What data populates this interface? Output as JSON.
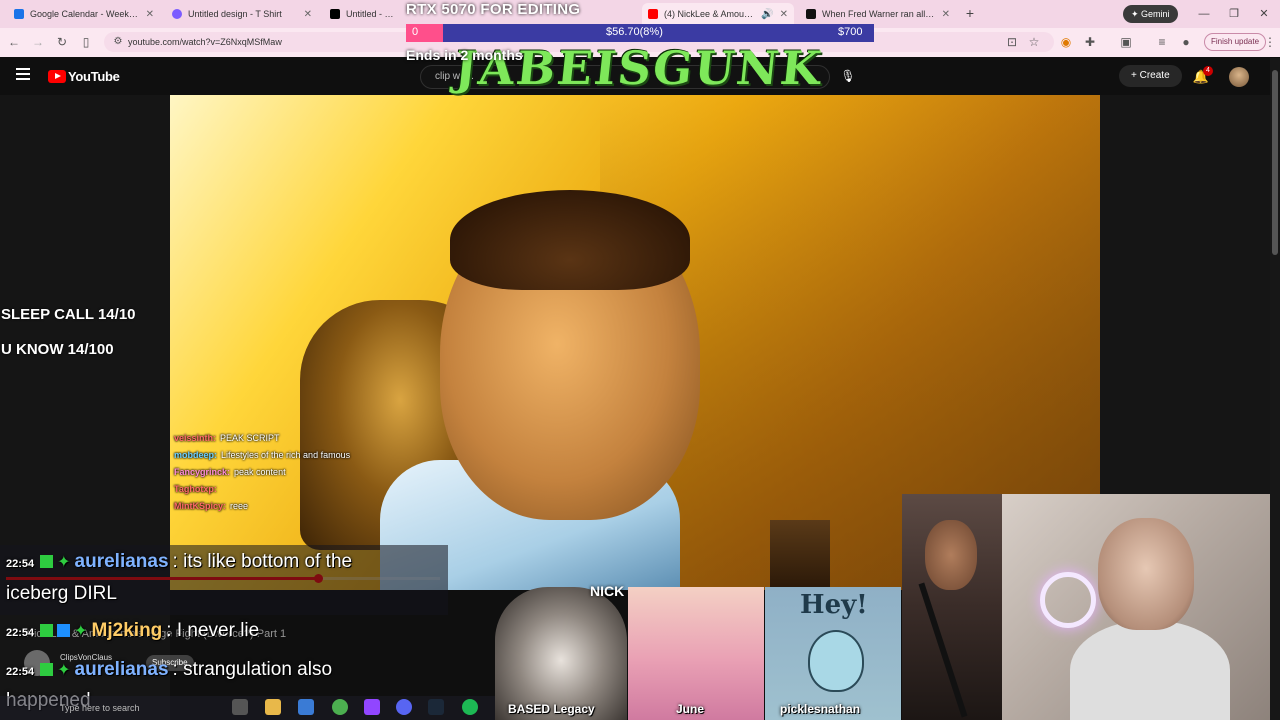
{
  "browser": {
    "tabs": [
      {
        "label": "Google Calendar - Week of Ma",
        "favicon_color": "#1a73e8",
        "active": false
      },
      {
        "label": "Untitled design - T Shirt",
        "favicon_color": "#7b5cff",
        "active": false
      },
      {
        "label": "Untitled - February 27, 2026",
        "favicon_color": "#000000",
        "active": false
      },
      {
        "label": "(4) NickLee & Amouranth",
        "favicon_color": "#ff0000",
        "active": true
      },
      {
        "label": "When Fred Warner ran all the w",
        "favicon_color": "#111111",
        "active": false
      }
    ],
    "gemini_label": "Gemini",
    "url": "youtube.com/watch?v=Z6NxqMSfMaw",
    "finish_update_label": "Finish update"
  },
  "youtube": {
    "logo_text": "YouTube",
    "search_placeholder": "clip wa...",
    "create_label": "Create",
    "notification_count": "4"
  },
  "stream_overlay": {
    "goal_title": "RTX 5070 FOR EDITING",
    "goal_start": "0",
    "goal_current": "$56.70(8%)",
    "goal_target": "$700",
    "goal_progress_percent": 8,
    "goal_ends": "Ends in 2 months",
    "logo_text": "JABEISGUNK"
  },
  "side_labels": {
    "sleep_call": "SLEEP CALL 14/10",
    "u_know": "U KNOW 14/100"
  },
  "mini_chat": [
    {
      "user": "veissinth:",
      "text": "PEAK SCRIPT",
      "color": "#ff6a6a"
    },
    {
      "user": "mobdeep:",
      "text": "Lifestyles of the rich and famous",
      "color": "#6ad0ff"
    },
    {
      "user": "Fancygrinck:",
      "text": "peak content",
      "color": "#ff8cd6"
    },
    {
      "user": "Taghotxp:",
      "text": "",
      "color": "#ff6a6a"
    },
    {
      "user": "MintKSpicy:",
      "text": "reee",
      "color": "#ff6a6a"
    }
  ],
  "video_progress_percent": 72,
  "big_chat": [
    {
      "time": "22:54",
      "user": "aurelianas",
      "text": ": its like bottom of the",
      "continuation": "iceberg DIRL",
      "user_color": "#7fb2ff"
    },
    {
      "time": "22:54",
      "user": "Mj2king",
      "text": ": I never lie",
      "user_color": "#ffcc66"
    },
    {
      "time": "22:54",
      "user": "aurelianas",
      "text": ": strangulation also",
      "continuation": "happened",
      "user_color": "#7fb2ff"
    }
  ],
  "ghost_title": "Nick Lee & Amouranth's Huge Fight (Divorce?) Part 1",
  "clip_channel": "ClipsVonClaus",
  "clip_subscribe": "Subscribe",
  "bottom_tiles": {
    "nick_tag": "NICK",
    "cat_label": "BASED Legacy",
    "june_label": "June",
    "hey_text": "Hey!",
    "hey_label": "picklesnathan"
  },
  "taskbar": {
    "search_placeholder": "Type here to search"
  }
}
